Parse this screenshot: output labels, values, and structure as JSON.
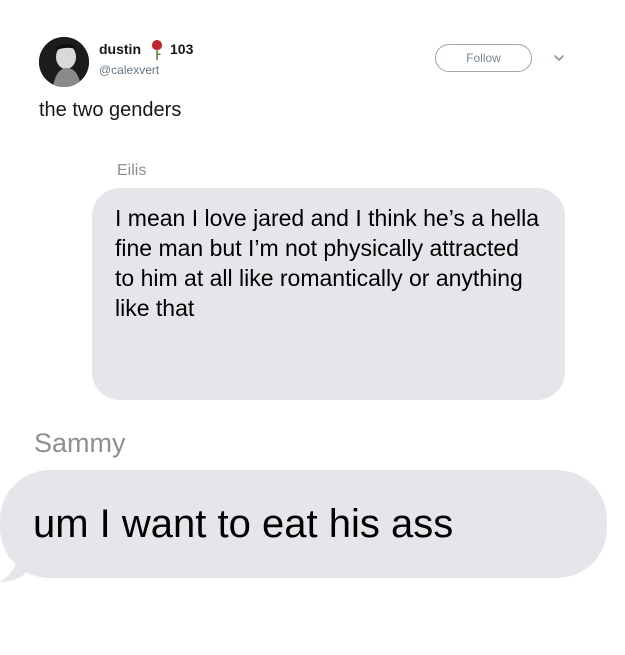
{
  "tweet": {
    "display_name": "dustin",
    "follower_count": "103",
    "handle": "@calexvert",
    "follow_label": "Follow",
    "text": "the two genders",
    "icons": {
      "badge": "rose-icon",
      "menu": "chevron-down-icon",
      "avatar": "avatar"
    },
    "colors": {
      "rose": "#c0262d",
      "follow_border": "#9aa6b0",
      "handle": "#657786"
    }
  },
  "conversation": {
    "messages": [
      {
        "sender": "Eilis",
        "text": "I mean I love jared and I think he’s a hella fine man but I’m not physically attracted to him at all like romantically or anything like that"
      },
      {
        "sender": "Sammy",
        "text": "um I want to eat his ass"
      }
    ],
    "colors": {
      "bubble": "#e5e5ea",
      "sender_name": "#8e8e93"
    }
  }
}
